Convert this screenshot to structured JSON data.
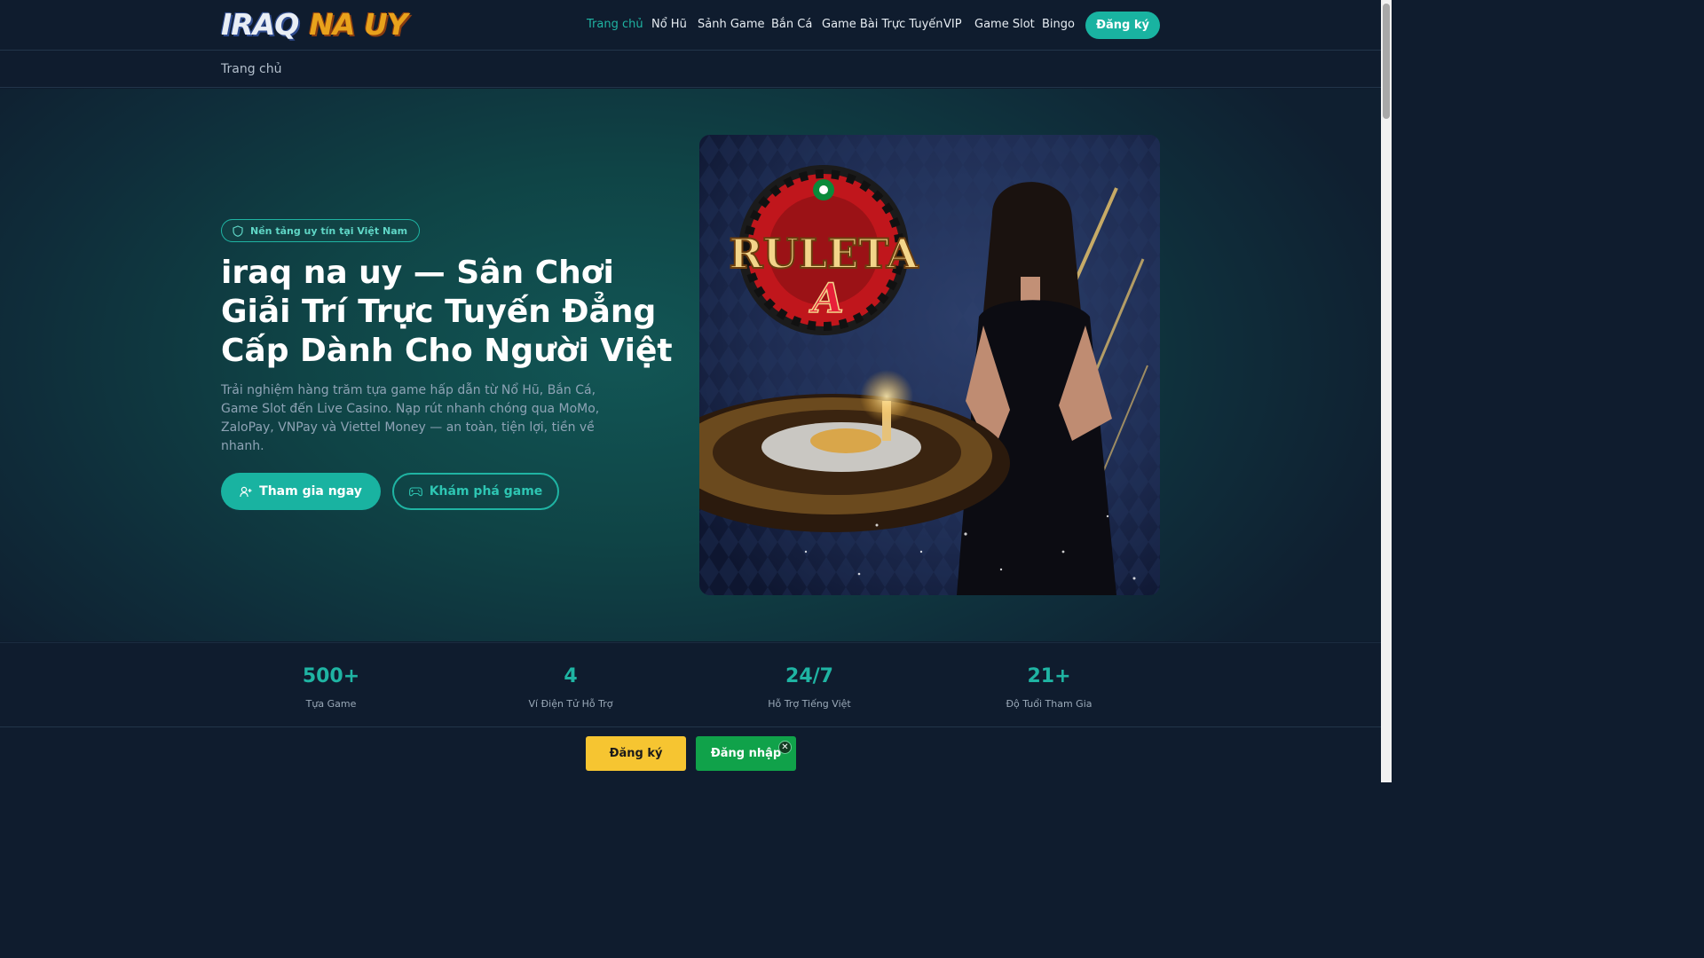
{
  "brand": {
    "logo_part1": "IRAQ",
    "logo_part2": "NA UY"
  },
  "nav": {
    "items": [
      {
        "label": "Trang chủ",
        "active": true
      },
      {
        "label": "Nổ Hũ"
      },
      {
        "label": "Sảnh Game"
      },
      {
        "label": "Bắn Cá"
      },
      {
        "label": "Game Bài Trực Tuyến"
      },
      {
        "label": "VIP"
      },
      {
        "label": "Game Slot"
      },
      {
        "label": "Bingo"
      }
    ],
    "register_label": "Đăng ký"
  },
  "breadcrumb": {
    "current": "Trang chủ"
  },
  "hero": {
    "badge": "Nền tảng uy tín tại Việt Nam",
    "title": "iraq na uy — Sân Chơi Giải Trí Trực Tuyến Đẳng Cấp Dành Cho Người Việt",
    "description": "Trải nghiệm hàng trăm tựa game hấp dẫn từ Nổ Hũ, Bắn Cá, Game Slot đến Live Casino. Nạp rút nhanh chóng qua MoMo, ZaloPay, VNPay và Viettel Money — an toàn, tiện lợi, tiền về nhanh.",
    "primary_cta": "Tham gia ngay",
    "secondary_cta": "Khám phá game",
    "image_text": "RULETA"
  },
  "stats": [
    {
      "value": "500+",
      "label": "Tựa Game"
    },
    {
      "value": "4",
      "label": "Ví Điện Tử Hỗ Trợ"
    },
    {
      "value": "24/7",
      "label": "Hỗ Trợ Tiếng Việt"
    },
    {
      "value": "21+",
      "label": "Độ Tuổi Tham Gia"
    }
  ],
  "bottom_bar": {
    "register_label": "Đăng ký",
    "login_label": "Đăng nhập",
    "close_label": "✕"
  },
  "colors": {
    "accent": "#19b3a1",
    "background": "#0f1c2e",
    "yellow": "#f6c531",
    "green": "#10a24a"
  }
}
